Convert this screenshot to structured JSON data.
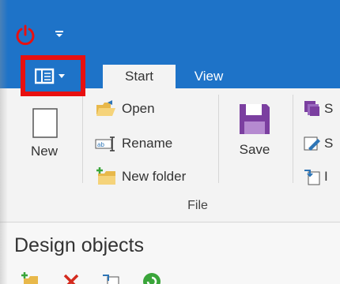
{
  "titlebar": {
    "accent_color": "#1e73c8",
    "power_icon": "power-icon",
    "qat_icon": "quick-access-dropdown-icon"
  },
  "app_menu": {
    "icon": "app-menu-icon",
    "highlight_color": "#e81010"
  },
  "tabs": [
    {
      "label": "Start",
      "active": true
    },
    {
      "label": "View",
      "active": false
    }
  ],
  "file_group": {
    "label": "File",
    "new_label": "New",
    "open_label": "Open",
    "rename_label": "Rename",
    "new_folder_label": "New folder",
    "save_label": "Save",
    "right_items": [
      {
        "label": "S"
      },
      {
        "label": "S"
      },
      {
        "label": "I"
      }
    ]
  },
  "panel": {
    "title": "Design objects"
  }
}
